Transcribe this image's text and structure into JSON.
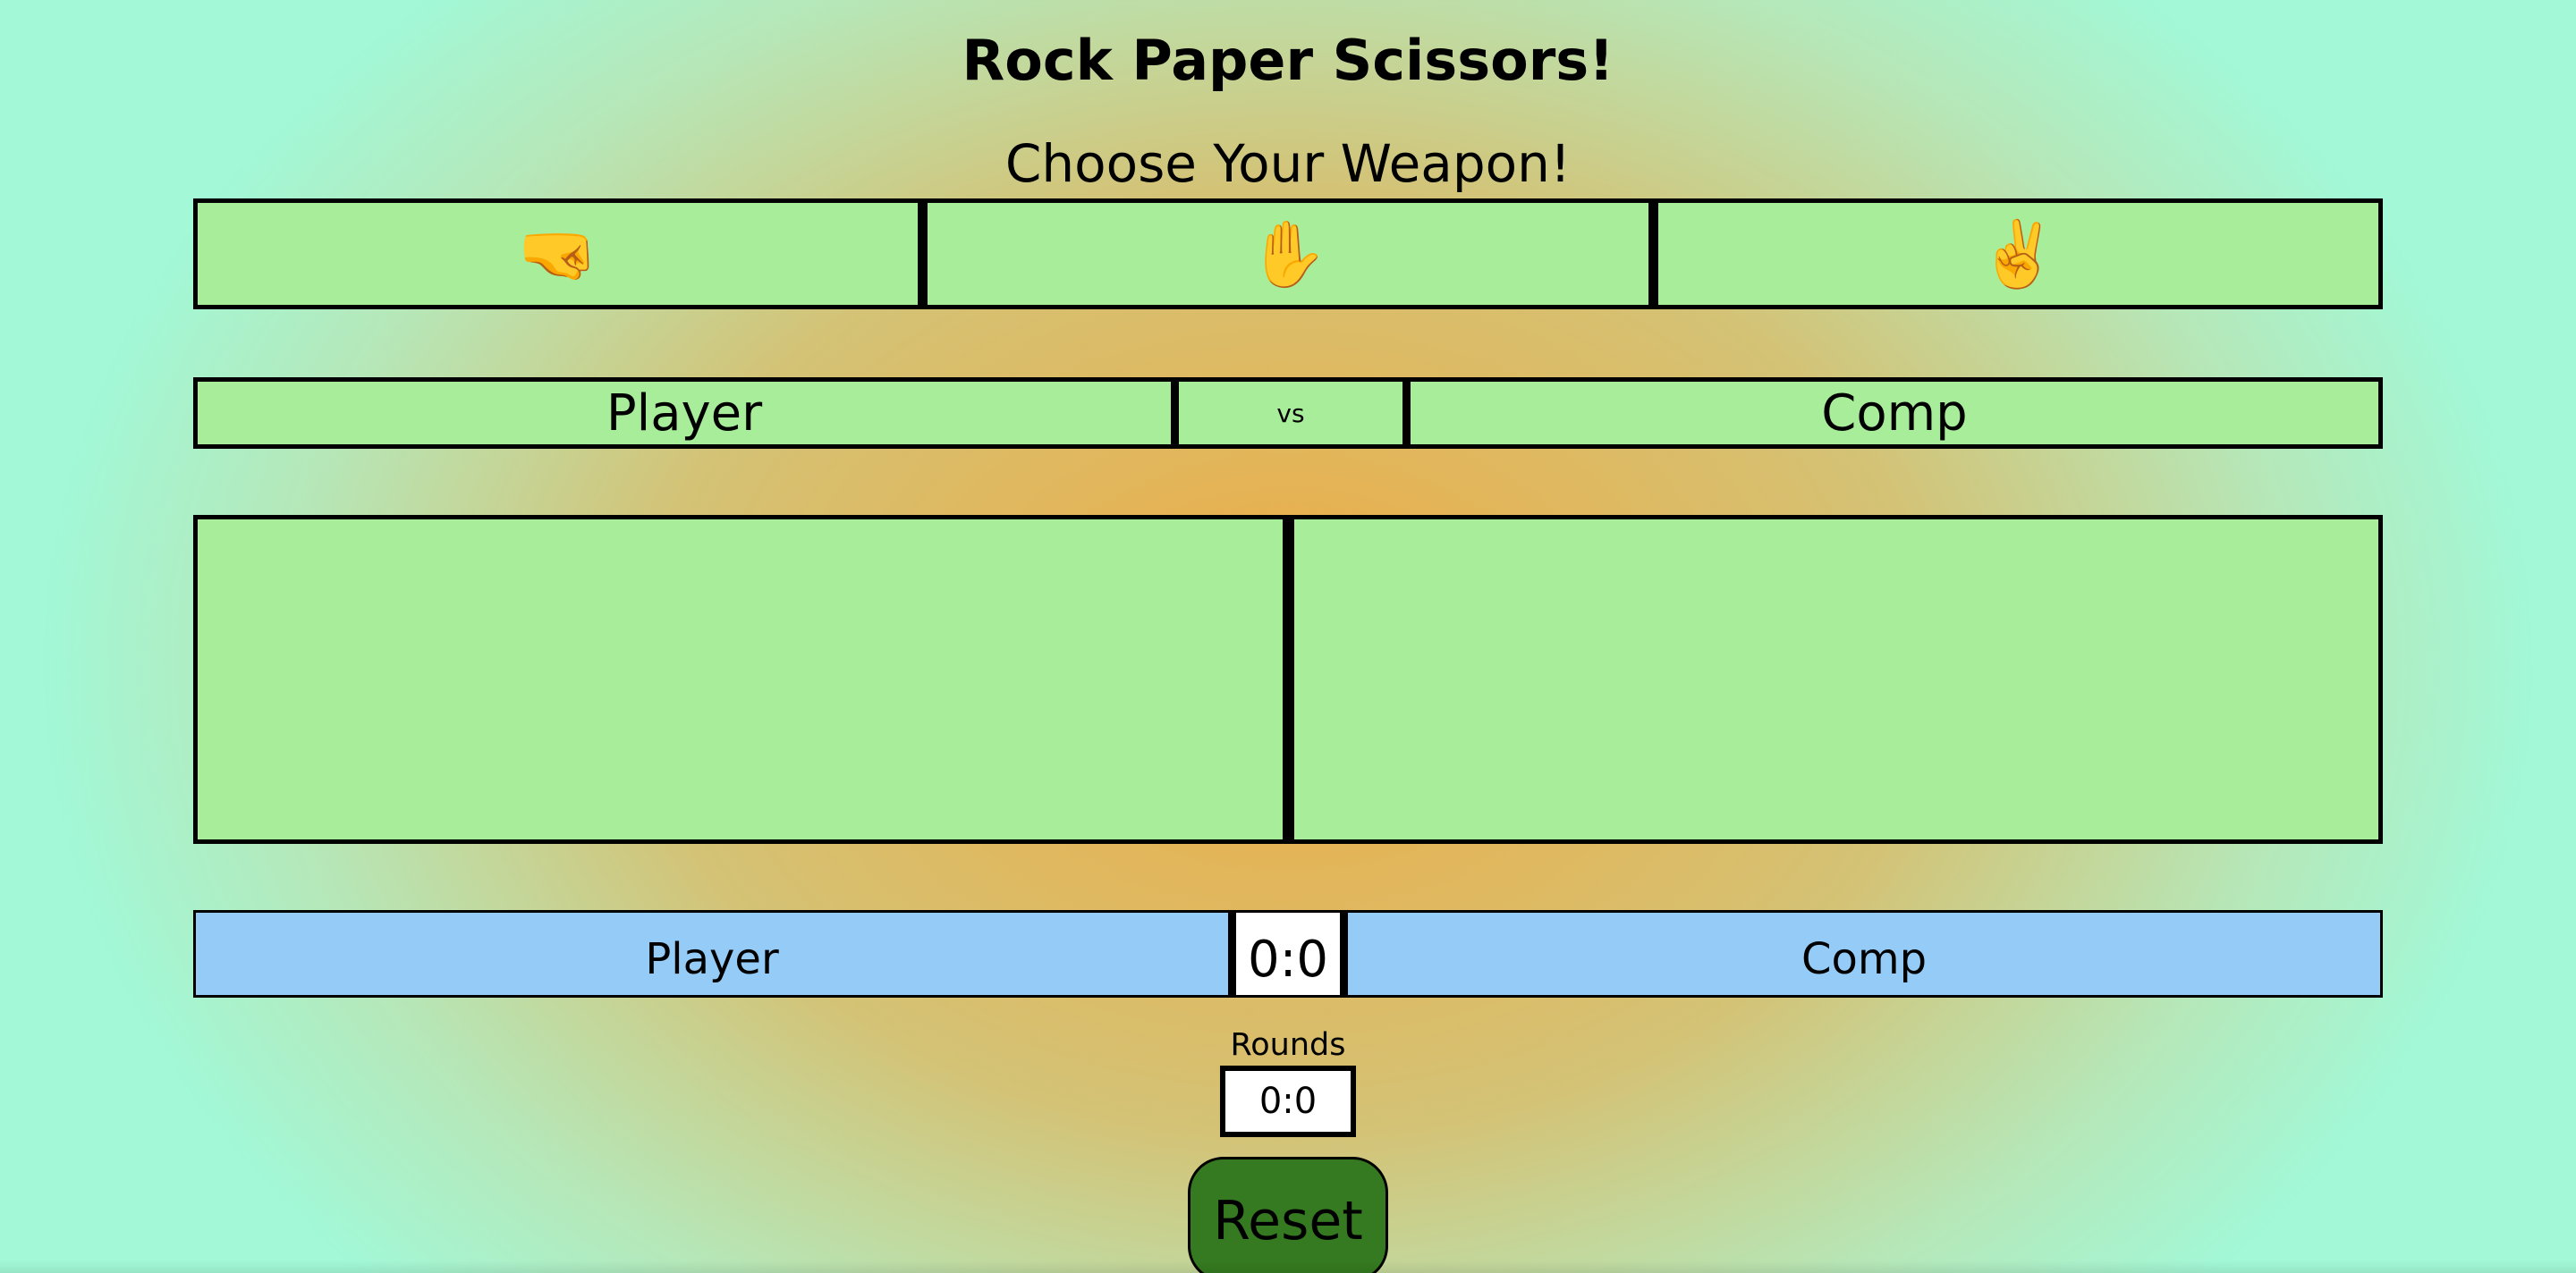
{
  "page": {
    "title": "Rock Paper Scissors!",
    "subtitle": "Choose Your Weapon!"
  },
  "weapons": [
    {
      "icon": "🤜",
      "icon_name": "rock-fist-icon"
    },
    {
      "icon": "✋",
      "icon_name": "paper-hand-icon"
    },
    {
      "icon": "✌️",
      "icon_name": "scissors-hand-icon"
    }
  ],
  "matchup": {
    "player_label": "Player",
    "vs_label": "vs",
    "comp_label": "Comp"
  },
  "arena": {
    "player_choice": "",
    "comp_choice": ""
  },
  "scoreboard": {
    "player_label": "Player",
    "score": "0:0",
    "comp_label": "Comp"
  },
  "rounds": {
    "label": "Rounds",
    "value": "0:0"
  },
  "reset": {
    "label": "Reset"
  },
  "colors": {
    "panel_green": "#a8ed9a",
    "score_blue": "#95ccf7",
    "reset_green": "#357a20",
    "background_outer": "#a2f8d7",
    "background_center": "#eea83d"
  }
}
